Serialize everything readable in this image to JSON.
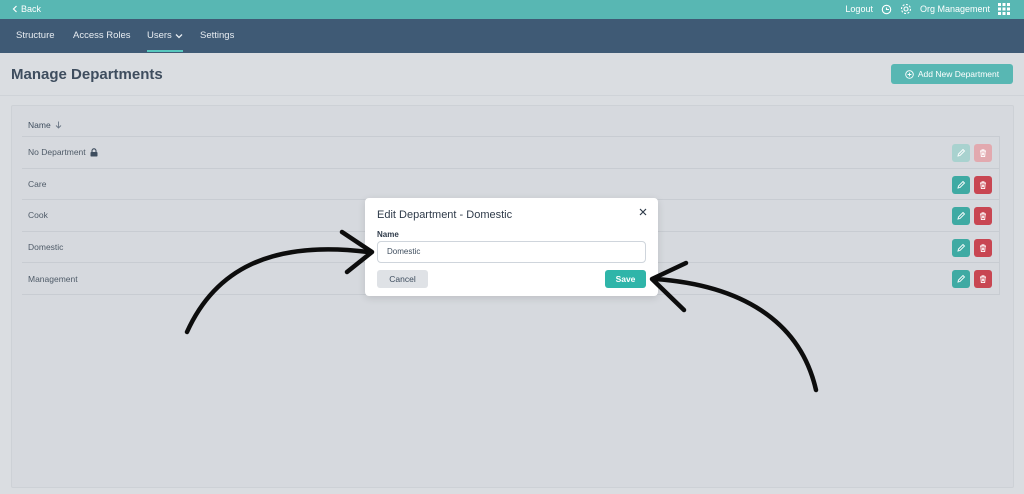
{
  "topbar": {
    "back_label": "Back",
    "logout_label": "Logout",
    "org_label": "Org Management"
  },
  "nav": {
    "tabs": [
      {
        "label": "Structure"
      },
      {
        "label": "Access Roles"
      },
      {
        "label": "Users",
        "active": true
      },
      {
        "label": "Settings"
      }
    ]
  },
  "page": {
    "title": "Manage Departments",
    "add_button_label": "Add New Department"
  },
  "table": {
    "column_header": "Name",
    "rows": [
      {
        "name": "No Department",
        "locked": true,
        "actions_disabled": true
      },
      {
        "name": "Care"
      },
      {
        "name": "Cook"
      },
      {
        "name": "Domestic"
      },
      {
        "name": "Management"
      }
    ]
  },
  "modal": {
    "title": "Edit Department - Domestic",
    "field_label": "Name",
    "field_value": "Domestic",
    "cancel_label": "Cancel",
    "save_label": "Save"
  },
  "colors": {
    "accent": "#58b7b3",
    "nav_bg": "#3f5a75",
    "delete": "#c84652",
    "save": "#2fb5a9"
  }
}
